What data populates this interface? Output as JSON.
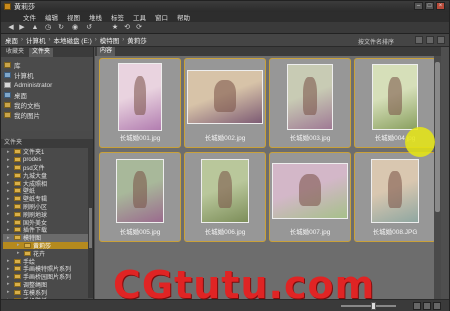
{
  "window": {
    "title": "黄莉莎"
  },
  "menu": [
    "文件",
    "编辑",
    "视图",
    "堆栈",
    "标签",
    "工具",
    "窗口",
    "帮助"
  ],
  "path": {
    "crumbs": [
      "桌面",
      "计算机",
      "本地磁盘 (E:)",
      "模特图",
      "黄莉莎"
    ],
    "sort_label": "按文件名排序"
  },
  "left_panel": {
    "tabs": [
      "收藏夹",
      "文件夹"
    ],
    "favorites": [
      {
        "label": "库",
        "icon": "library-icon"
      },
      {
        "label": "计算机",
        "icon": "computer-icon"
      },
      {
        "label": "Administrator",
        "icon": "user-folder-icon"
      },
      {
        "label": "桌面",
        "icon": "desktop-icon"
      },
      {
        "label": "我的文档",
        "icon": "documents-icon"
      },
      {
        "label": "我的图片",
        "icon": "pictures-icon"
      }
    ],
    "folders_header": "文件夹",
    "tree": [
      "文件夹1",
      "prodes",
      "psd文件",
      "九城大盘",
      "大成照相",
      "壁纸",
      "壁纸专辑",
      "刷刷小区",
      "刷刷地球",
      "国外美女",
      "插件下载",
      "模特图",
      "黄莉莎",
      "花卉",
      "手绘",
      "手画模特照片系列",
      "手画桥园图片系列",
      "调整绳图",
      "车模系列",
      "手机壁纸"
    ]
  },
  "content": {
    "tab_label": "内容",
    "thumbnails": [
      {
        "name": "长城婚001.jpg",
        "palette": [
          "#e9d3df",
          "#b27db0"
        ]
      },
      {
        "name": "长城婚002.jpg",
        "palette": [
          "#d7c3a8",
          "#7d5b74"
        ]
      },
      {
        "name": "长城婚003.jpg",
        "palette": [
          "#c8cbb4",
          "#a07a95"
        ]
      },
      {
        "name": "长城婚004.jpg",
        "palette": [
          "#d6dfb9",
          "#8aa060"
        ]
      },
      {
        "name": "长城婚005.jpg",
        "palette": [
          "#a8b89a",
          "#9b6b8e"
        ]
      },
      {
        "name": "长城婚006.jpg",
        "palette": [
          "#b9c79b",
          "#7d8e5a"
        ]
      },
      {
        "name": "长城婚007.jpg",
        "palette": [
          "#d3b7c8",
          "#a6c08a"
        ]
      },
      {
        "name": "长城婚008.JPG",
        "palette": [
          "#d9c7b0",
          "#8fa7a1"
        ]
      }
    ]
  },
  "watermark": "CGtutu.com",
  "colors": {
    "accent": "#c9a13a",
    "selection": "#b58a1e",
    "watermark": "#e02424"
  }
}
